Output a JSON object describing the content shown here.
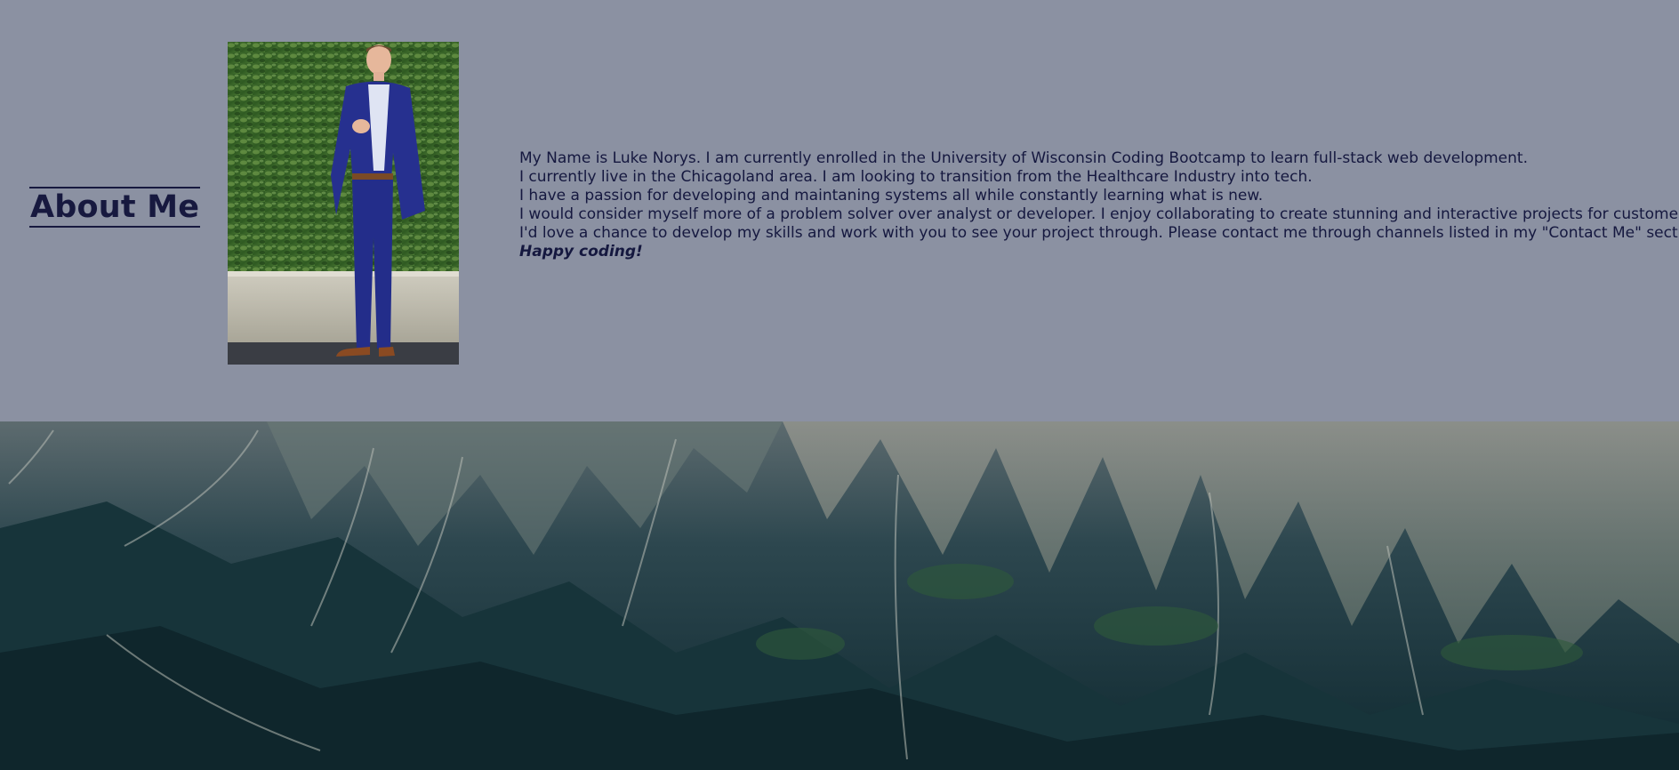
{
  "about": {
    "heading": "About Me",
    "bio_lines": [
      "My Name is Luke Norys. I am currently enrolled in the University of Wisconsin Coding Bootcamp to learn full-stack web development.",
      "I currently live in the Chicagoland area. I am looking to transition from the Healthcare Industry into tech.",
      "I have a passion for developing and maintaning systems all while constantly learning what is new.",
      "I would consider myself more of a problem solver over analyst or developer. I enjoy collaborating to create stunning and interactive projects for customers.",
      "I'd love a chance to develop my skills and work with you to see your project through. Please contact me through channels listed in my \"Contact Me\" section."
    ],
    "signoff": "Happy coding!"
  },
  "images": {
    "portrait": "portrait-photo",
    "banner": "mountain-landscape-photo"
  },
  "colors": {
    "about_background": "#8b91a2",
    "heading_text": "#17193f",
    "body_text": "#15183f",
    "banner_dark": "#16303a"
  }
}
